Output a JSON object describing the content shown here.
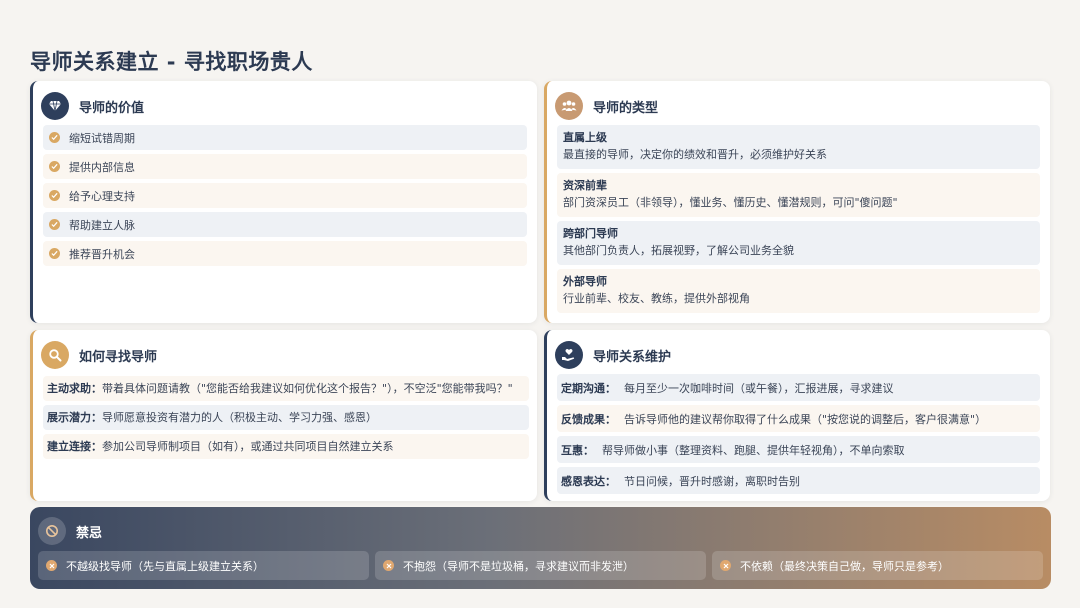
{
  "page_title": "导师关系建立 - 寻找职场贵人",
  "colors": {
    "navy": "#2e3f5c",
    "gold": "#d9a863",
    "tan": "#c89a72"
  },
  "value_card": {
    "title": "导师的价值",
    "icon": "diamond-icon",
    "items": [
      "缩短试错周期",
      "提供内部信息",
      "给予心理支持",
      "帮助建立人脉",
      "推荐晋升机会"
    ]
  },
  "types_card": {
    "title": "导师的类型",
    "icon": "group-icon",
    "items": [
      {
        "name": "直属上级",
        "desc": "最直接的导师，决定你的绩效和晋升，必须维护好关系"
      },
      {
        "name": "资深前辈",
        "desc": "部门资深员工（非领导），懂业务、懂历史、懂潜规则，可问\"傻问题\""
      },
      {
        "name": "跨部门导师",
        "desc": "其他部门负责人，拓展视野，了解公司业务全貌"
      },
      {
        "name": "外部导师",
        "desc": "行业前辈、校友、教练，提供外部视角"
      }
    ]
  },
  "find_card": {
    "title": "如何寻找导师",
    "icon": "search-icon",
    "items": [
      {
        "key": "主动求助：",
        "text": "带着具体问题请教（\"您能否给我建议如何优化这个报告？\"），不空泛\"您能带我吗？\""
      },
      {
        "key": "展示潜力：",
        "text": "导师愿意投资有潜力的人（积极主动、学习力强、感恩）"
      },
      {
        "key": "建立连接：",
        "text": "参加公司导师制项目（如有），或通过共同项目自然建立关系"
      }
    ]
  },
  "maintain_card": {
    "title": "导师关系维护",
    "icon": "heart-hand-icon",
    "items": [
      {
        "key": "定期沟通：",
        "text": "每月至少一次咖啡时间（或午餐），汇报进展，寻求建议"
      },
      {
        "key": "反馈成果：",
        "text": "告诉导师他的建议帮你取得了什么成果（\"按您说的调整后，客户很满意\"）"
      },
      {
        "key": "互惠：",
        "text": "帮导师做小事（整理资料、跑腿、提供年轻视角），不单向索取"
      },
      {
        "key": "感恩表达：",
        "text": "节日问候，晋升时感谢，离职时告别"
      }
    ]
  },
  "taboo": {
    "title": "禁忌",
    "icon": "ban-icon",
    "items": [
      "不越级找导师（先与直属上级建立关系）",
      "不抱怨（导师不是垃圾桶，寻求建议而非发泄）",
      "不依赖（最终决策自己做，导师只是参考）"
    ]
  }
}
